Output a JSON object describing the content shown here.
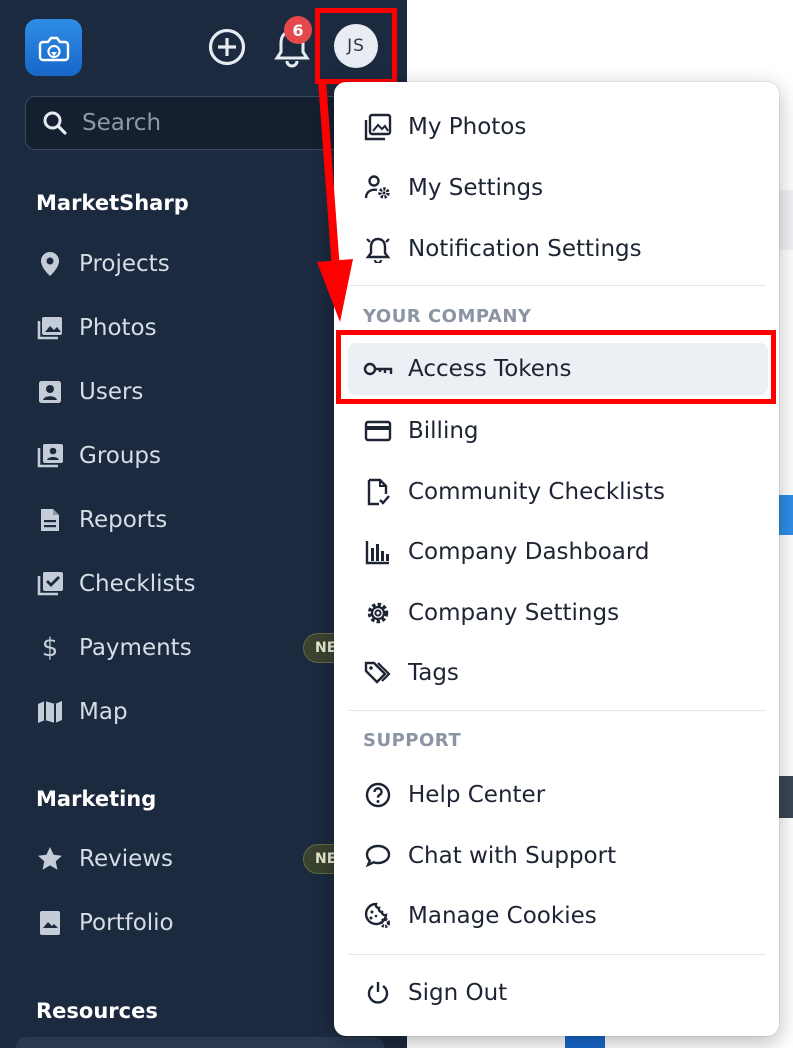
{
  "header": {
    "notification_count": "6",
    "avatar_initials": "JS"
  },
  "search": {
    "placeholder": "Search"
  },
  "sidebar": {
    "sections": [
      {
        "title": "MarketSharp"
      },
      {
        "title": "Marketing"
      },
      {
        "title": "Resources"
      }
    ],
    "items": [
      {
        "label": "Projects",
        "icon": "map-pin-icon"
      },
      {
        "label": "Photos",
        "icon": "photos-icon"
      },
      {
        "label": "Users",
        "icon": "user-badge-icon"
      },
      {
        "label": "Groups",
        "icon": "groups-icon"
      },
      {
        "label": "Reports",
        "icon": "document-icon"
      },
      {
        "label": "Checklists",
        "icon": "checklist-icon"
      },
      {
        "label": "Payments",
        "icon": "dollar-icon",
        "badge": "NE"
      },
      {
        "label": "Map",
        "icon": "map-icon"
      },
      {
        "label": "Reviews",
        "icon": "star-icon",
        "badge": "NE"
      },
      {
        "label": "Portfolio",
        "icon": "portfolio-icon"
      }
    ]
  },
  "menu": {
    "personal": [
      {
        "label": "My Photos",
        "icon": "image-icon"
      },
      {
        "label": "My Settings",
        "icon": "user-gear-icon"
      },
      {
        "label": "Notification Settings",
        "icon": "bell-alert-icon"
      }
    ],
    "company_title": "YOUR COMPANY",
    "company": [
      {
        "label": "Access Tokens",
        "icon": "key-icon"
      },
      {
        "label": "Billing",
        "icon": "credit-card-icon"
      },
      {
        "label": "Community Checklists",
        "icon": "checklist-doc-icon"
      },
      {
        "label": "Company Dashboard",
        "icon": "bar-chart-icon"
      },
      {
        "label": "Company Settings",
        "icon": "gear-icon"
      },
      {
        "label": "Tags",
        "icon": "tags-icon"
      }
    ],
    "support_title": "SUPPORT",
    "support": [
      {
        "label": "Help Center",
        "icon": "help-circle-icon"
      },
      {
        "label": "Chat with Support",
        "icon": "chat-bubble-icon"
      },
      {
        "label": "Manage Cookies",
        "icon": "cookie-gear-icon"
      }
    ],
    "signout": {
      "label": "Sign Out",
      "icon": "power-icon"
    }
  },
  "colors": {
    "sidebar_bg": "#1c2a3f",
    "accent_blue": "#2f8de6",
    "annotation_red": "#ff0000",
    "badge_red": "#e5484d"
  }
}
